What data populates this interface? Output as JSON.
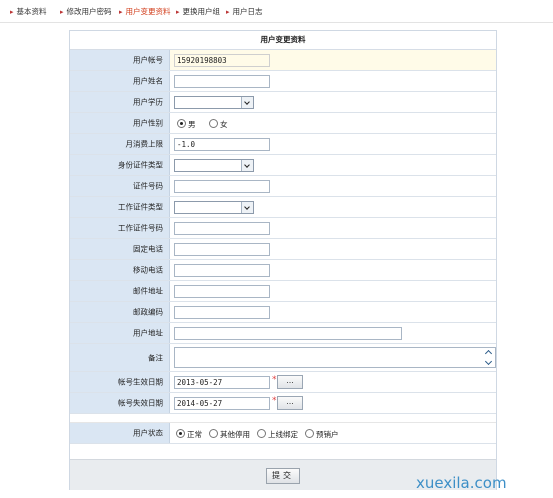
{
  "breadcrumb": [
    "基本资料",
    "修改用户密码",
    "用户变更资料",
    "更换用户组",
    "用户日志"
  ],
  "form": {
    "title": "用户变更资料",
    "labels": {
      "account": "用户帐号",
      "name": "用户姓名",
      "education": "用户学历",
      "gender": "用户性别",
      "monthly_limit": "月消费上限",
      "id_type": "身份证件类型",
      "id_number": "证件号码",
      "work_id_type": "工作证件类型",
      "work_id_number": "工作证件号码",
      "landline": "固定电话",
      "mobile": "移动电话",
      "email": "邮件地址",
      "postcode": "邮政编码",
      "address": "用户地址",
      "remark": "备注",
      "effective_date": "帐号生效日期",
      "expiry_date": "帐号失效日期",
      "status": "用户状态"
    },
    "values": {
      "account": "15920198803",
      "monthly_limit": "-1.0",
      "effective_date": "2013-05-27",
      "expiry_date": "2014-05-27"
    },
    "gender_options": [
      "男",
      "女"
    ],
    "gender_selected": "男",
    "status_options": [
      "正常",
      "其他停用",
      "上线绑定",
      "预销户"
    ],
    "status_selected": "正常",
    "required_mark": "*",
    "picker_label": "...",
    "submit_label": "提交"
  },
  "watermark": "xuexila.com"
}
